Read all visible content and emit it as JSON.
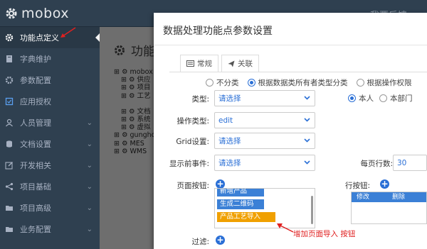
{
  "app": {
    "brand": "mobox",
    "feedback": "我要反馈"
  },
  "sidebar": {
    "items": [
      {
        "label": "功能点定义",
        "icon": "gear-icon",
        "active": true
      },
      {
        "label": "字典维护",
        "icon": "book-icon"
      },
      {
        "label": "参数配置",
        "icon": "gear-icon"
      },
      {
        "label": "应用授权",
        "icon": "authorize-icon"
      },
      {
        "label": "人员管理",
        "icon": "user-icon"
      },
      {
        "label": "文档设置",
        "icon": "database-icon"
      },
      {
        "label": "开发相关",
        "icon": "edit-icon"
      },
      {
        "label": "项目基础",
        "icon": "share-icon"
      },
      {
        "label": "项目高级",
        "icon": "folder-icon"
      },
      {
        "label": "业务配置",
        "icon": "folder-icon"
      }
    ]
  },
  "main": {
    "title": "功能",
    "tree": [
      "⊞ ⚙ mobox",
      "⊞ ⚙ 供应",
      "⊞ ⚙ 项目",
      "⊞ ⚙ 工艺",
      "⊞ ⚙ 文档",
      "⊞ ⚙ 系统",
      "⊞ ⚙ 虚拟",
      "⊞ ⚙ gunghc",
      "⊞ ⚙ MES",
      "⊞ ⚙ WMS"
    ]
  },
  "modal": {
    "title": "数据处理功能点参数设置",
    "tabs": [
      {
        "label": "常规",
        "icon": "list-icon"
      },
      {
        "label": "关联",
        "icon": "send-icon"
      }
    ],
    "classify_options": [
      "不分类",
      "根据数据类所有者类型分类",
      "根据操作权限"
    ],
    "owner_options": [
      "本人",
      "本部门"
    ],
    "fields": {
      "type_label": "类型:",
      "type_value": "请选择",
      "op_type_label": "操作类型:",
      "op_type_value": "edit",
      "grid_label": "Grid设置:",
      "grid_value": "请选择",
      "pre_event_label": "显示前事件:",
      "pre_event_value": "请选择",
      "page_size_label": "每页行数:",
      "page_size_value": "30",
      "page_buttons_label": "页面按钮:",
      "row_buttons_label": "行按钮:",
      "filter_label": "过滤:"
    },
    "page_buttons": [
      "新增产品",
      "生成二维码",
      "产品工艺导入"
    ],
    "row_buttons_headers": [
      "修改",
      "删除"
    ]
  },
  "annotation": {
    "text": "增加页面导入 按钮",
    "color": "#e02020"
  }
}
